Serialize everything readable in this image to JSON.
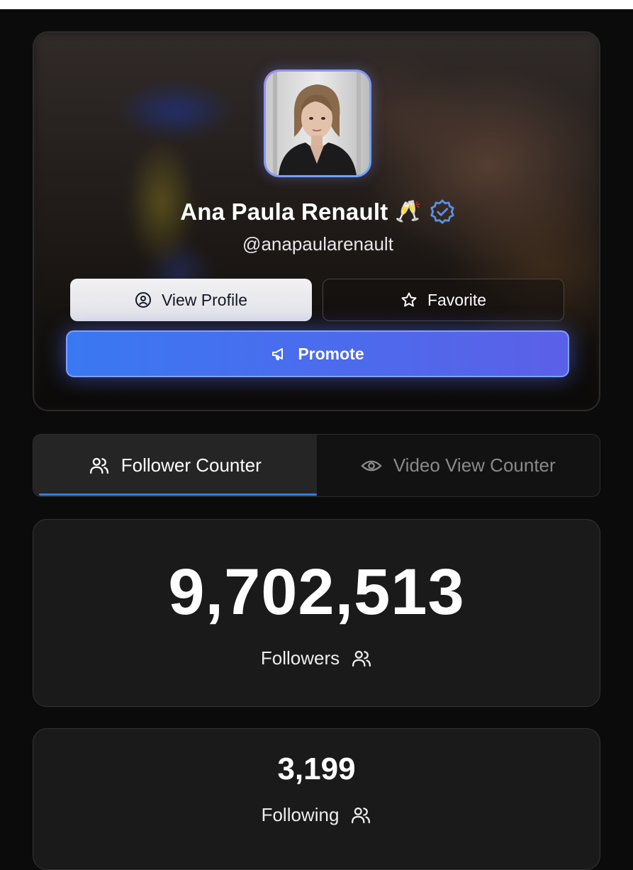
{
  "profile": {
    "name": "Ana Paula Renault",
    "name_emoji": "🥂",
    "handle": "@anapaularenault",
    "verified": true,
    "avatar_alt": "Ana Paula Renault"
  },
  "actions": {
    "view_profile_label": "View Profile",
    "favorite_label": "Favorite",
    "promote_label": "Promote"
  },
  "tabs": [
    {
      "label": "Follower Counter",
      "icon": "users-icon",
      "active": true
    },
    {
      "label": "Video View Counter",
      "icon": "eye-icon",
      "active": false
    }
  ],
  "stats": {
    "followers": {
      "value": "9,702,513",
      "label": "Followers",
      "icon": "users-icon"
    },
    "following": {
      "value": "3,199",
      "label": "Following",
      "icon": "users-icon"
    }
  },
  "colors": {
    "accent": "#2f7df0",
    "promote_gradient_start": "#3a78f2",
    "promote_gradient_end": "#5b60e8",
    "verified": "#5b8fe8",
    "background": "#0b0b0b",
    "card": "#1a1a1a"
  }
}
